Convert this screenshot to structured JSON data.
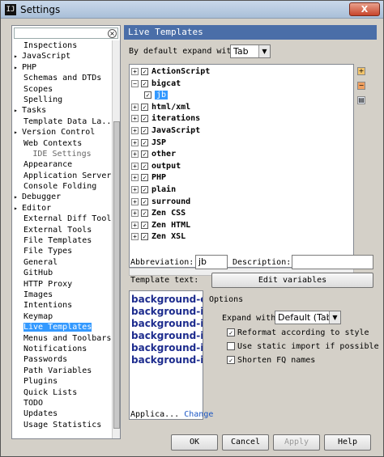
{
  "window": {
    "title": "Settings",
    "icon": "IJ",
    "close_label": "X"
  },
  "search": {
    "value": "",
    "clear_icon": "×"
  },
  "sidebar": {
    "items": [
      {
        "label": "Inspections",
        "expandable": false
      },
      {
        "label": "JavaScript",
        "expandable": true
      },
      {
        "label": "PHP",
        "expandable": true
      },
      {
        "label": "Schemas and DTDs",
        "expandable": false
      },
      {
        "label": "Scopes",
        "expandable": false
      },
      {
        "label": "Spelling",
        "expandable": false
      },
      {
        "label": "Tasks",
        "expandable": true
      },
      {
        "label": "Template Data La...",
        "expandable": false
      },
      {
        "label": "Version Control",
        "expandable": true
      },
      {
        "label": "Web Contexts",
        "expandable": false
      },
      {
        "label": "IDE Settings",
        "section": true
      },
      {
        "label": "Appearance",
        "expandable": false
      },
      {
        "label": "Application Servers",
        "expandable": false
      },
      {
        "label": "Console Folding",
        "expandable": false
      },
      {
        "label": "Debugger",
        "expandable": true
      },
      {
        "label": "Editor",
        "expandable": true
      },
      {
        "label": "External Diff Tools",
        "expandable": false
      },
      {
        "label": "External Tools",
        "expandable": false
      },
      {
        "label": "File Templates",
        "expandable": false
      },
      {
        "label": "File Types",
        "expandable": false
      },
      {
        "label": "General",
        "expandable": false
      },
      {
        "label": "GitHub",
        "expandable": false
      },
      {
        "label": "HTTP Proxy",
        "expandable": false
      },
      {
        "label": "Images",
        "expandable": false
      },
      {
        "label": "Intentions",
        "expandable": false
      },
      {
        "label": "Keymap",
        "expandable": false
      },
      {
        "label": "Live Templates",
        "expandable": false,
        "selected": true
      },
      {
        "label": "Menus and Toolbars",
        "expandable": false
      },
      {
        "label": "Notifications",
        "expandable": false
      },
      {
        "label": "Passwords",
        "expandable": false
      },
      {
        "label": "Path Variables",
        "expandable": false
      },
      {
        "label": "Plugins",
        "expandable": false
      },
      {
        "label": "Quick Lists",
        "expandable": false
      },
      {
        "label": "TODO",
        "expandable": false
      },
      {
        "label": "Updates",
        "expandable": false
      },
      {
        "label": "Usage Statistics",
        "expandable": false
      }
    ]
  },
  "panel": {
    "title": "Live Templates",
    "expand_label": "By default expand with",
    "expand_value": "Tab",
    "templates": [
      {
        "label": "ActionScript",
        "checked": true
      },
      {
        "label": "bigcat",
        "checked": true,
        "expanded": true
      },
      {
        "label": "jb",
        "checked": true,
        "child": true
      },
      {
        "label": "html/xml",
        "checked": true
      },
      {
        "label": "iterations",
        "checked": true
      },
      {
        "label": "JavaScript",
        "checked": true
      },
      {
        "label": "JSP",
        "checked": true
      },
      {
        "label": "other",
        "checked": true
      },
      {
        "label": "output",
        "checked": true
      },
      {
        "label": "PHP",
        "checked": true
      },
      {
        "label": "plain",
        "checked": true
      },
      {
        "label": "surround",
        "checked": true
      },
      {
        "label": "Zen CSS",
        "checked": true
      },
      {
        "label": "Zen HTML",
        "checked": true
      },
      {
        "label": "Zen XSL",
        "checked": true
      }
    ],
    "side_icons": [
      "add-icon",
      "remove-icon",
      "copy-icon"
    ],
    "abbreviation_label": "Abbreviation:",
    "abbreviation_value": "jb",
    "description_label": "Description:",
    "description_value": "",
    "template_text_label": "Template text:",
    "template_text_lines": [
      "background-co",
      "background-im",
      "background-im",
      "background-im",
      "background-im",
      "background-im"
    ],
    "edit_variables_label": "Edit variables",
    "options": {
      "title": "Options",
      "expand_with_label": "Expand with",
      "expand_with_value": "Default (Tab)",
      "reformat_label": "Reformat according to style",
      "reformat_checked": true,
      "static_import_label": "Use static import if possible",
      "static_import_checked": false,
      "shorten_label": "Shorten FQ names",
      "shorten_checked": true
    },
    "applicable_label": "Applica...",
    "change_link": "Change"
  },
  "buttons": {
    "ok": "OK",
    "cancel": "Cancel",
    "apply": "Apply",
    "help": "Help"
  },
  "colors": {
    "accent": "#3399ff",
    "header": "#4a6ea8",
    "template_text": "#1d2c8e"
  }
}
